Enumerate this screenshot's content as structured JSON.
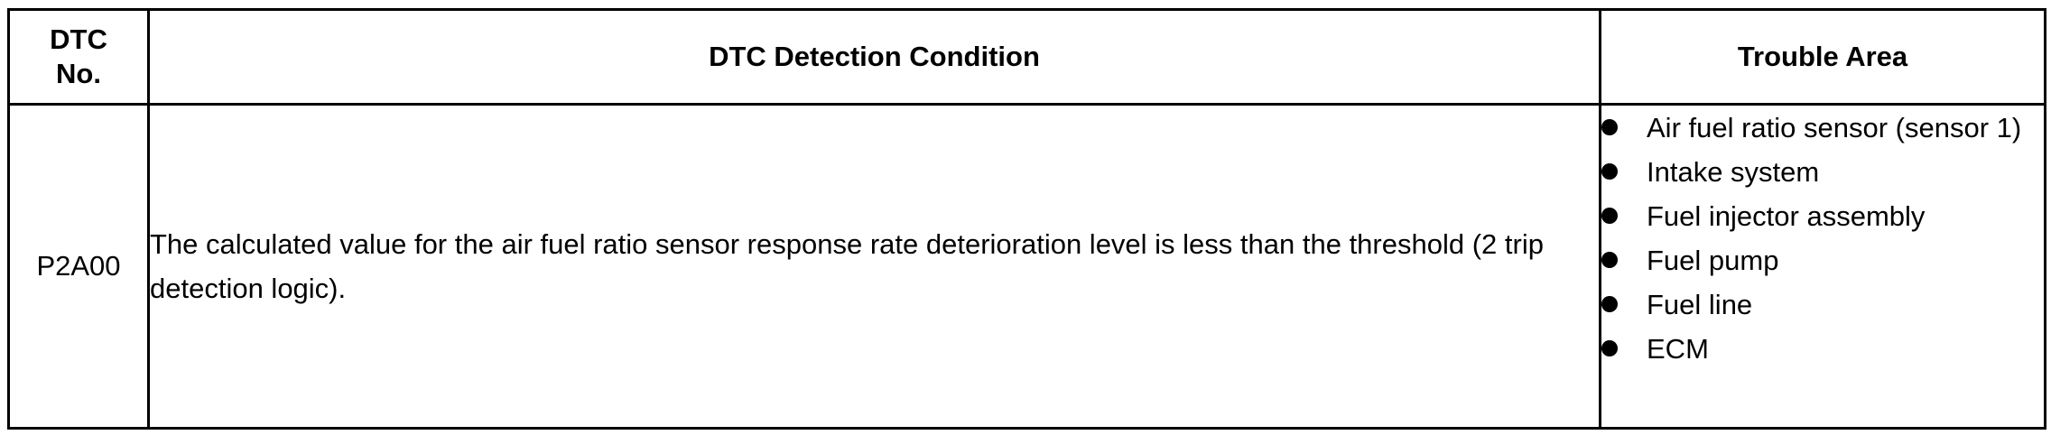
{
  "table": {
    "headers": {
      "dtc_no": "DTC\nNo.",
      "condition": "DTC Detection Condition",
      "trouble_area": "Trouble Area"
    },
    "rows": [
      {
        "dtc_no": "P2A00",
        "condition": "The calculated value for the air fuel ratio sensor response rate deterioration level is less than the threshold (2 trip detection logic).",
        "trouble_areas": [
          "Air fuel ratio sensor (sensor 1)",
          "Intake system",
          "Fuel injector assembly",
          "Fuel pump",
          "Fuel line",
          "ECM"
        ]
      }
    ]
  }
}
